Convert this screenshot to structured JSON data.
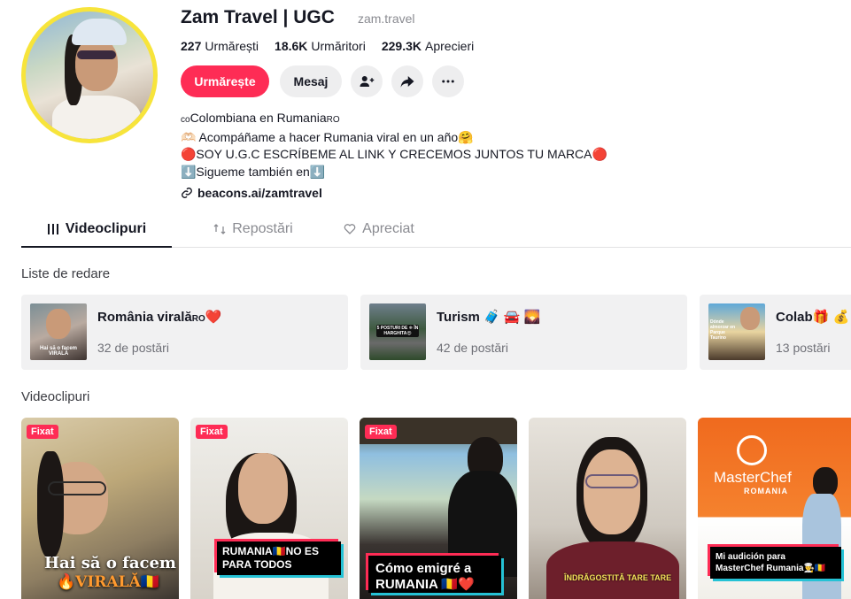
{
  "profile": {
    "name": "Zam Travel | UGC",
    "handle": "zam.travel",
    "stats": {
      "following_count": "227",
      "following_label": "Urmărești",
      "followers_count": "18.6K",
      "followers_label": "Urmăritori",
      "likes_count": "229.3K",
      "likes_label": "Aprecieri"
    },
    "follow_label": "Urmărește",
    "message_label": "Mesaj",
    "bio": {
      "line1_prefix": "co",
      "line1_text": "Colombiana en Rumania",
      "line1_suffix": "RO",
      "line2": "🫶🏻 Acompáñame a hacer Rumania viral en un año🤗",
      "line3": "🔴SOY U.G.C ESCRÍBEME AL LINK Y CRECEMOS JUNTOS TU MARCA🔴",
      "line4": "⬇️Sigueme también en⬇️"
    },
    "link": "beacons.ai/zamtravel"
  },
  "tabs": {
    "videos": "Videoclipuri",
    "reposts": "Repostări",
    "liked": "Apreciat"
  },
  "playlists": {
    "section_label": "Liste de redare",
    "items": [
      {
        "title": "România virală",
        "title_suffix": "RO",
        "title_emoji": "❤️",
        "count": "32 de postări",
        "thumb_text": "Hai să o facem VIRALĂ"
      },
      {
        "title": "Turism",
        "title_emoji": "🧳 🚘 🌄",
        "count": "42 de postări",
        "thumb_text": "5 POSTURI DE ❄ ÎN HARGHITA😍"
      },
      {
        "title": "Colab",
        "title_emoji": "🎁 💰",
        "count": "13 postări",
        "thumb_text": "Dónde almorzar en Parque Taurino"
      }
    ]
  },
  "videos": {
    "section_label": "Videoclipuri",
    "pinned_label": "Fixat",
    "items": [
      {
        "caption": "Hai să o facem",
        "caption2": "🔥VIRALĂ🇷🇴"
      },
      {
        "caption": "RUMANIA🇷🇴NO ES PARA TODOS"
      },
      {
        "caption": "Cómo emigré a",
        "caption2": "RUMANIA 🇷🇴❤️"
      },
      {
        "caption": "ÎNDRĂGOSTITĂ TARE TARE"
      },
      {
        "caption": "Mi audición para MasterChef Rumania👨‍🍳🇷🇴",
        "logo": "MasterChef",
        "logo_sub": "ROMANIA"
      }
    ]
  },
  "colors": {
    "accent": "#fe2c55",
    "avatar_ring": "#f7e43b",
    "button_gray": "#eeeeef",
    "card_bg": "#f1f1f2"
  }
}
